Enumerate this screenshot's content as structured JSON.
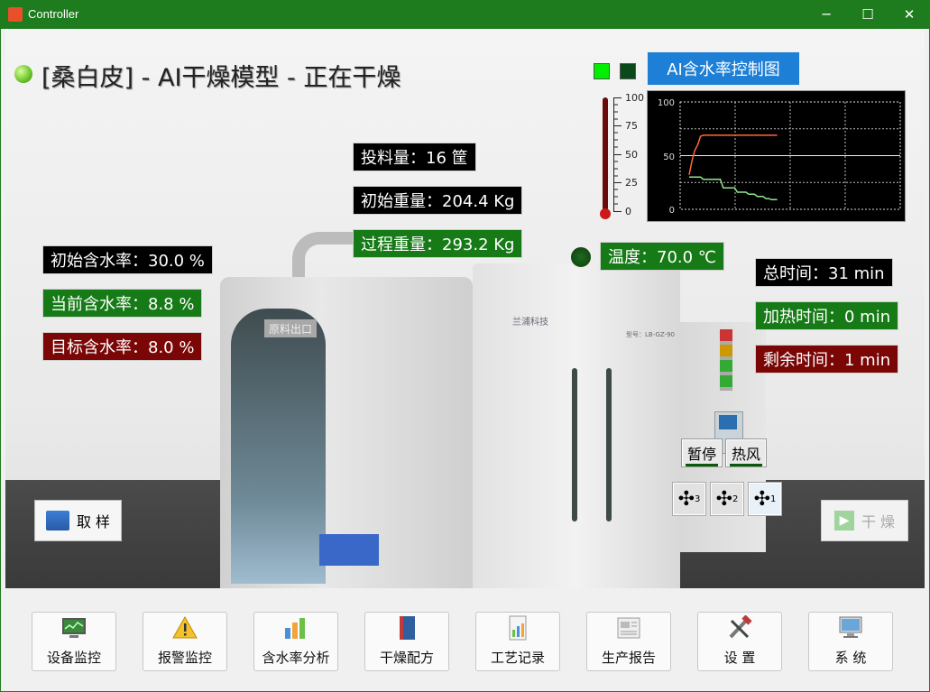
{
  "window": {
    "title": "Controller",
    "minimize": "─",
    "maximize": "☐",
    "close": "✕"
  },
  "header": {
    "title": "[桑白皮] - AI干燥模型 - 正在干燥"
  },
  "ai_chart_button": "AI含水率控制图",
  "machine": {
    "plate": "原料出口",
    "brand": "兰浦科技",
    "model": "型号：LB-GZ-90"
  },
  "info": {
    "feed": "投料量：16 筐",
    "initial_weight": "初始重量：204.4 Kg",
    "process_weight": "过程重量：293.2 Kg",
    "temperature": "温度：70.0 ℃",
    "initial_moisture": "初始含水率：30.0 %",
    "current_moisture": "当前含水率：8.8 %",
    "target_moisture": "目标含水率：8.0 %",
    "total_time": "总时间：31 min",
    "heating_time": "加热时间：0 min",
    "remaining_time": "剩余时间：1 min"
  },
  "thermometer": {
    "ticks": [
      "100",
      "75",
      "50",
      "25",
      "0"
    ],
    "level": 0
  },
  "controls": {
    "pause": "暂停",
    "hot_air": "热风",
    "fans": [
      "3",
      "2",
      "1"
    ],
    "sample": "取 样",
    "dry": "干 燥"
  },
  "chart_data": {
    "type": "line",
    "ylim": [
      0,
      100
    ],
    "yticks": [
      "100",
      "50",
      "0"
    ],
    "grid": true,
    "series": [
      {
        "color": "#ff6a3a",
        "x": [
          0,
          1,
          2,
          3,
          4,
          5,
          6,
          7,
          8,
          9,
          10,
          11,
          12,
          13,
          14,
          15,
          16,
          17,
          18,
          19,
          20,
          21,
          22,
          23,
          24,
          25,
          26,
          27,
          28,
          29,
          30,
          31
        ],
        "values": [
          32,
          45,
          55,
          60,
          68,
          69,
          69,
          69,
          69,
          69,
          69,
          69,
          69,
          69,
          69,
          69,
          69,
          69,
          69,
          69,
          69,
          69,
          69,
          69,
          69,
          69,
          69,
          69,
          69,
          69,
          69,
          69
        ]
      },
      {
        "color": "#8fe88f",
        "x": [
          0,
          1,
          2,
          3,
          4,
          5,
          6,
          7,
          8,
          9,
          10,
          11,
          12,
          13,
          14,
          15,
          16,
          17,
          18,
          19,
          20,
          21,
          22,
          23,
          24,
          25,
          26,
          27,
          28,
          29,
          30,
          31
        ],
        "values": [
          30,
          30,
          30,
          30,
          30,
          28,
          28,
          28,
          28,
          28,
          28,
          28,
          20,
          20,
          20,
          20,
          20,
          16,
          16,
          16,
          16,
          14,
          14,
          14,
          12,
          12,
          12,
          10,
          10,
          9,
          9,
          9
        ]
      }
    ]
  },
  "nav": [
    "设备监控",
    "报警监控",
    "含水率分析",
    "干燥配方",
    "工艺记录",
    "生产报告",
    "设  置",
    "系  统"
  ]
}
